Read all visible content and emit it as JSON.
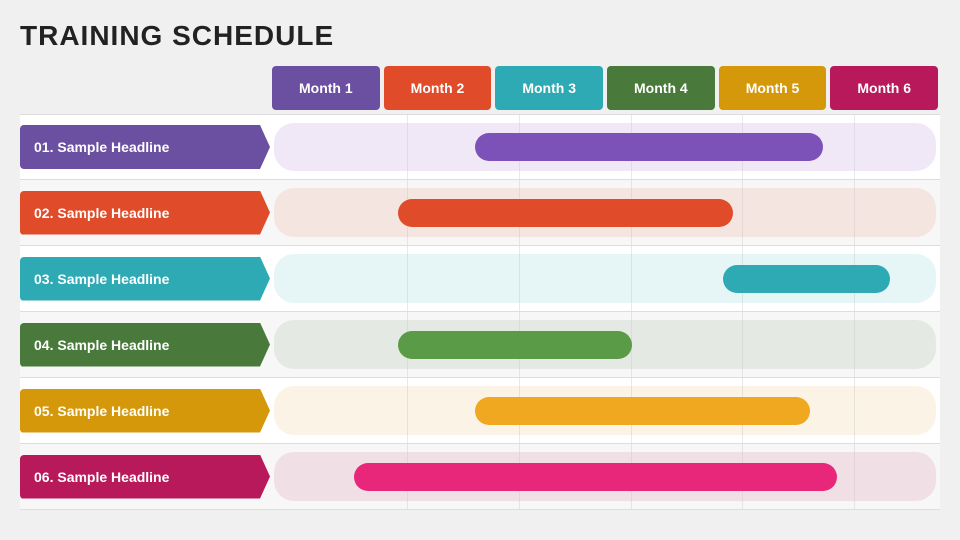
{
  "title": "TRAINING SCHEDULE",
  "months": [
    {
      "label": "Month 1",
      "color": "#6b4fa0"
    },
    {
      "label": "Month 2",
      "color": "#e04b2a"
    },
    {
      "label": "Month 3",
      "color": "#2eaab5"
    },
    {
      "label": "Month 4",
      "color": "#4a7a3b"
    },
    {
      "label": "Month 5",
      "color": "#d4980a"
    },
    {
      "label": "Month 6",
      "color": "#b8195a"
    }
  ],
  "rows": [
    {
      "label": "01. Sample Headline",
      "labelColor": "#6b4fa0",
      "bgColor": "rgba(160,100,200,0.15)",
      "barColor": "#7c52b8",
      "barStart": 0.3,
      "barWidth": 0.52
    },
    {
      "label": "02. Sample Headline",
      "labelColor": "#e04b2a",
      "bgColor": "rgba(224,75,42,0.1)",
      "barColor": "#e04b2a",
      "barStart": 0.185,
      "barWidth": 0.5
    },
    {
      "label": "03. Sample Headline",
      "labelColor": "#2eaab5",
      "bgColor": "rgba(46,170,181,0.12)",
      "barColor": "#2eaab5",
      "barStart": 0.67,
      "barWidth": 0.25
    },
    {
      "label": "04. Sample Headline",
      "labelColor": "#4a7a3b",
      "bgColor": "rgba(74,122,59,0.1)",
      "barColor": "#5a9b48",
      "barStart": 0.185,
      "barWidth": 0.35
    },
    {
      "label": "05. Sample Headline",
      "labelColor": "#d4980a",
      "bgColor": "rgba(212,152,10,0.1)",
      "barColor": "#f0a820",
      "barStart": 0.3,
      "barWidth": 0.5
    },
    {
      "label": "06. Sample Headline",
      "labelColor": "#b8195a",
      "bgColor": "rgba(184,25,90,0.1)",
      "barColor": "#e8277a",
      "barStart": 0.12,
      "barWidth": 0.72
    }
  ]
}
